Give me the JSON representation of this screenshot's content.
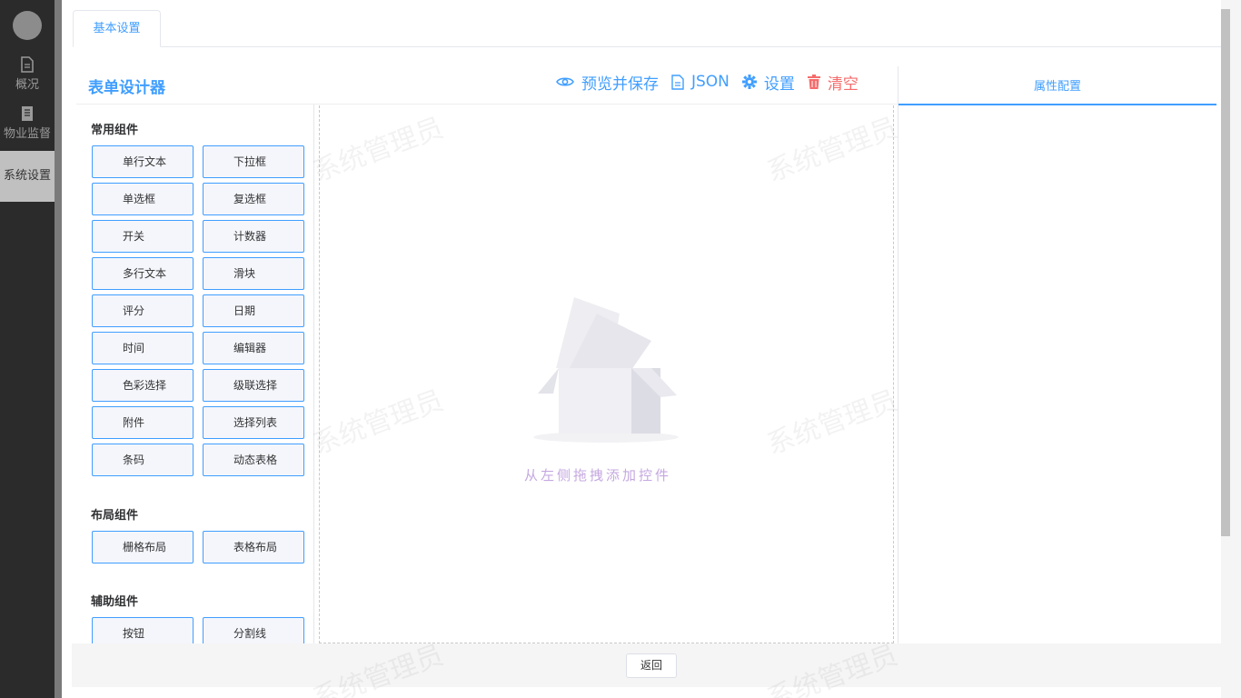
{
  "sidebar": {
    "items": [
      {
        "label": "概况",
        "icon": "document-icon"
      },
      {
        "label": "物业监督",
        "icon": "book-icon"
      },
      {
        "label": "系统设置",
        "icon": "settings-icon"
      }
    ]
  },
  "tabs": [
    {
      "label": "基本设置"
    }
  ],
  "designer": {
    "title": "表单设计器"
  },
  "toolbar": {
    "preview_label": "预览并保存",
    "json_label": "JSON",
    "settings_label": "设置",
    "clear_label": "清空",
    "accent": "#409eff",
    "danger": "#f56c6c"
  },
  "groups": [
    {
      "title": "常用组件",
      "items": [
        "单行文本",
        "下拉框",
        "单选框",
        "复选框",
        "开关",
        "计数器",
        "多行文本",
        "滑块",
        "评分",
        "日期",
        "时间",
        "编辑器",
        "色彩选择",
        "级联选择",
        "附件",
        "选择列表",
        "条码",
        "动态表格"
      ]
    },
    {
      "title": "布局组件",
      "items": [
        "栅格布局",
        "表格布局"
      ]
    },
    {
      "title": "辅助组件",
      "items": [
        "按钮",
        "分割线"
      ]
    }
  ],
  "canvas": {
    "empty_text": "从左侧拖拽添加控件"
  },
  "properties": {
    "tab_label": "属性配置"
  },
  "footer": {
    "back_label": "返回"
  },
  "watermark": {
    "text": "系统管理员"
  }
}
